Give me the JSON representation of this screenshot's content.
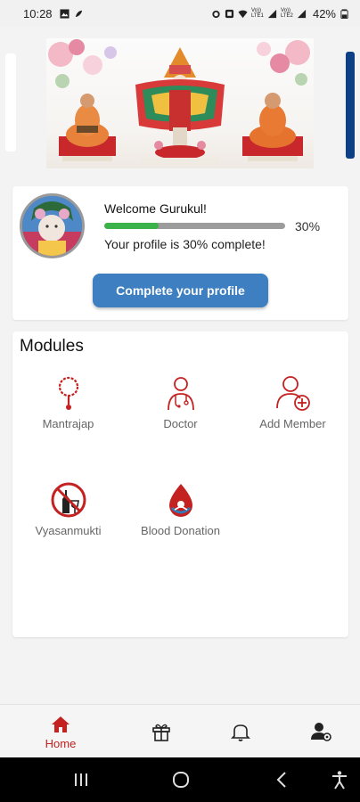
{
  "status_bar": {
    "time": "10:28",
    "net1": "Vo)) LTE1",
    "net2": "Vo)) LTE2",
    "battery": "42%"
  },
  "profile": {
    "welcome": "Welcome Gurukul!",
    "progress_percent": 30,
    "progress_label": "30%",
    "status_text": "Your profile is 30% complete!",
    "complete_button": "Complete your profile"
  },
  "modules": {
    "title": "Modules",
    "items": [
      {
        "label": "Mantrajap",
        "icon": "mala-beads-icon"
      },
      {
        "label": "Doctor",
        "icon": "doctor-icon"
      },
      {
        "label": "Add Member",
        "icon": "add-user-icon"
      },
      {
        "label": "Vyasanmukti",
        "icon": "no-alcohol-icon"
      },
      {
        "label": "Blood Donation",
        "icon": "blood-drop-icon"
      }
    ]
  },
  "bottom_nav": {
    "home": "Home",
    "items": [
      "home-icon",
      "gift-icon",
      "bell-icon",
      "profile-settings-icon"
    ]
  },
  "colors": {
    "accent_red": "#c42121",
    "button_blue": "#3d7fc1",
    "progress_green": "#3cb34a"
  }
}
